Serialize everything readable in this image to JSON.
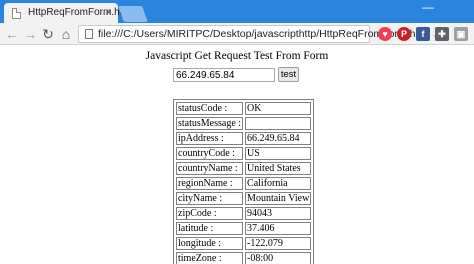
{
  "browser": {
    "tab_title": "HttpReqFromForm.html",
    "tab_close": "×",
    "new_tab_icon": "new-tab-icon",
    "minimize_glyph": "—",
    "back_glyph": "←",
    "forward_glyph": "→",
    "reload_glyph": "↻",
    "home_glyph": "⌂",
    "url": "file:///C:/Users/MIRITPC/Desktop/javascripthttp/HttpReqFromForm.h...",
    "star_glyph": "☆",
    "extensions": [
      {
        "name": "pocket-icon",
        "color": "#ef4056",
        "glyph": "♥"
      },
      {
        "name": "pinterest-icon",
        "color": "#cb2027",
        "glyph": "P"
      },
      {
        "name": "facebook-icon",
        "color": "#3b5998",
        "glyph": "f"
      },
      {
        "name": "puzzle-icon",
        "color": "#5f6368",
        "glyph": "✚"
      },
      {
        "name": "image-icon",
        "color": "#9aa0a6",
        "glyph": "▣"
      }
    ]
  },
  "page": {
    "heading": "Javascript Get Request Test From Form",
    "ip_input_value": "66.249.65.84",
    "test_button_label": "test"
  },
  "result": {
    "rows": [
      {
        "key": "statusCode :",
        "value": "OK"
      },
      {
        "key": "statusMessage :",
        "value": ""
      },
      {
        "key": "ipAddress :",
        "value": "66.249.65.84"
      },
      {
        "key": "countryCode :",
        "value": "US"
      },
      {
        "key": "countryName :",
        "value": "United States"
      },
      {
        "key": "regionName :",
        "value": "California"
      },
      {
        "key": "cityName :",
        "value": "Mountain View"
      },
      {
        "key": "zipCode :",
        "value": "94043"
      },
      {
        "key": "latitude :",
        "value": "37.406"
      },
      {
        "key": "longitude :",
        "value": "-122.079"
      },
      {
        "key": "timeZone :",
        "value": "-08:00"
      }
    ]
  }
}
